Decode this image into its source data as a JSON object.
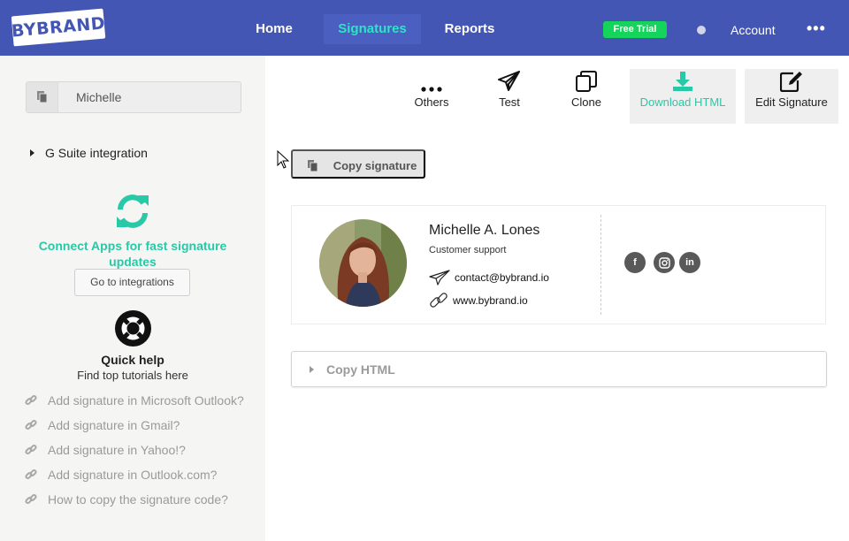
{
  "brand": {
    "logo_text": "BYBRAND",
    "primary": "#4356b3",
    "accent": "#27c9a6",
    "trial_green": "#14d45c"
  },
  "nav": {
    "items": [
      {
        "label": "Home"
      },
      {
        "label": "Signatures",
        "active": true
      },
      {
        "label": "Reports"
      }
    ],
    "trial_badge": "Free Trial",
    "account_label": "Account",
    "more_label": "•••"
  },
  "sidebar": {
    "selector_value": "Michelle",
    "gsuite_label": "G Suite integration",
    "connect_text": "Connect Apps for fast signature updates",
    "go_integrations_label": "Go to integrations",
    "quick_help_title": "Quick help",
    "quick_help_sub": "Find top tutorials here",
    "help_links": [
      {
        "label": "Add signature in Microsoft Outlook?"
      },
      {
        "label": "Add signature in Gmail?"
      },
      {
        "label": "Add signature in Yahoo!?"
      },
      {
        "label": "Add signature in Outlook.com?"
      },
      {
        "label": "How to copy the signature code?"
      }
    ]
  },
  "toolbar": {
    "others_label": "Others",
    "test_label": "Test",
    "clone_label": "Clone",
    "download_label": "Download HTML",
    "edit_label": "Edit Signature"
  },
  "copy_signature_label": "Copy signature",
  "signature": {
    "name": "Michelle A. Lones",
    "role": "Customer support",
    "email": "contact@bybrand.io",
    "website": "www.bybrand.io",
    "social": [
      {
        "icon": "facebook-icon",
        "glyph": "f"
      },
      {
        "icon": "instagram-icon",
        "glyph": ""
      },
      {
        "icon": "linkedin-icon",
        "glyph": "in"
      }
    ]
  },
  "copy_html_label": "Copy HTML"
}
